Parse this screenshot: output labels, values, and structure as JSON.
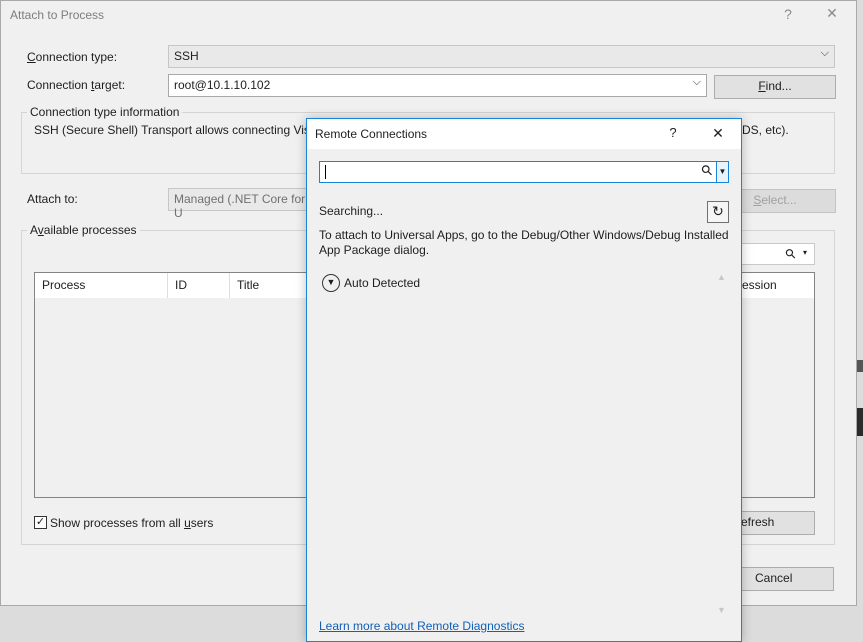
{
  "main_dialog": {
    "title": "Attach to Process",
    "help_glyph": "?",
    "close_glyph": "✕",
    "connection_type_label_pre": "",
    "connection_type_label_u": "C",
    "connection_type_label_post": "onnection type:",
    "connection_type_value": "SSH",
    "connection_target_label_pre": "Connection ",
    "connection_target_label_u": "t",
    "connection_target_label_post": "arget:",
    "connection_target_value": "root@10.1.10.102",
    "find_button_pre": "",
    "find_button_u": "F",
    "find_button_post": "ind...",
    "info_group_caption": "Connection type information",
    "info_text_left": "SSH (Secure Shell) Transport allows connecting Visu",
    "info_text_right": "DS, etc).",
    "attach_to_label": "Attach to:",
    "attach_to_value": "Managed (.NET Core for U",
    "select_button_pre": "",
    "select_button_u": "S",
    "select_button_post": "elect...",
    "available_processes_pre": "A",
    "available_processes_u": "v",
    "available_processes_post": "ailable processes",
    "filter_icon_glyph": "⚲",
    "columns": [
      "Process",
      "ID",
      "Title",
      "ession"
    ],
    "show_all_users_pre": "Show processes from all ",
    "show_all_users_u": "u",
    "show_all_users_post": "sers",
    "show_all_users_checked": true,
    "refresh_button_partial": "efresh",
    "cancel_button": "Cancel"
  },
  "remote_connections": {
    "title": "Remote Connections",
    "help_glyph": "?",
    "close_glyph": "✕",
    "search_value": "",
    "search_icon_glyph": "⚲",
    "status": "Searching...",
    "info_text": "To attach to Universal Apps, go to the Debug/Other Windows/Debug Installed App Package dialog.",
    "section_auto_detected": "Auto Detected",
    "learn_more_link": "Learn more about Remote Diagnostics"
  },
  "colors": {
    "accent": "#1883d7",
    "link": "#1160b7",
    "dialog_bg": "#f0f0f0"
  }
}
